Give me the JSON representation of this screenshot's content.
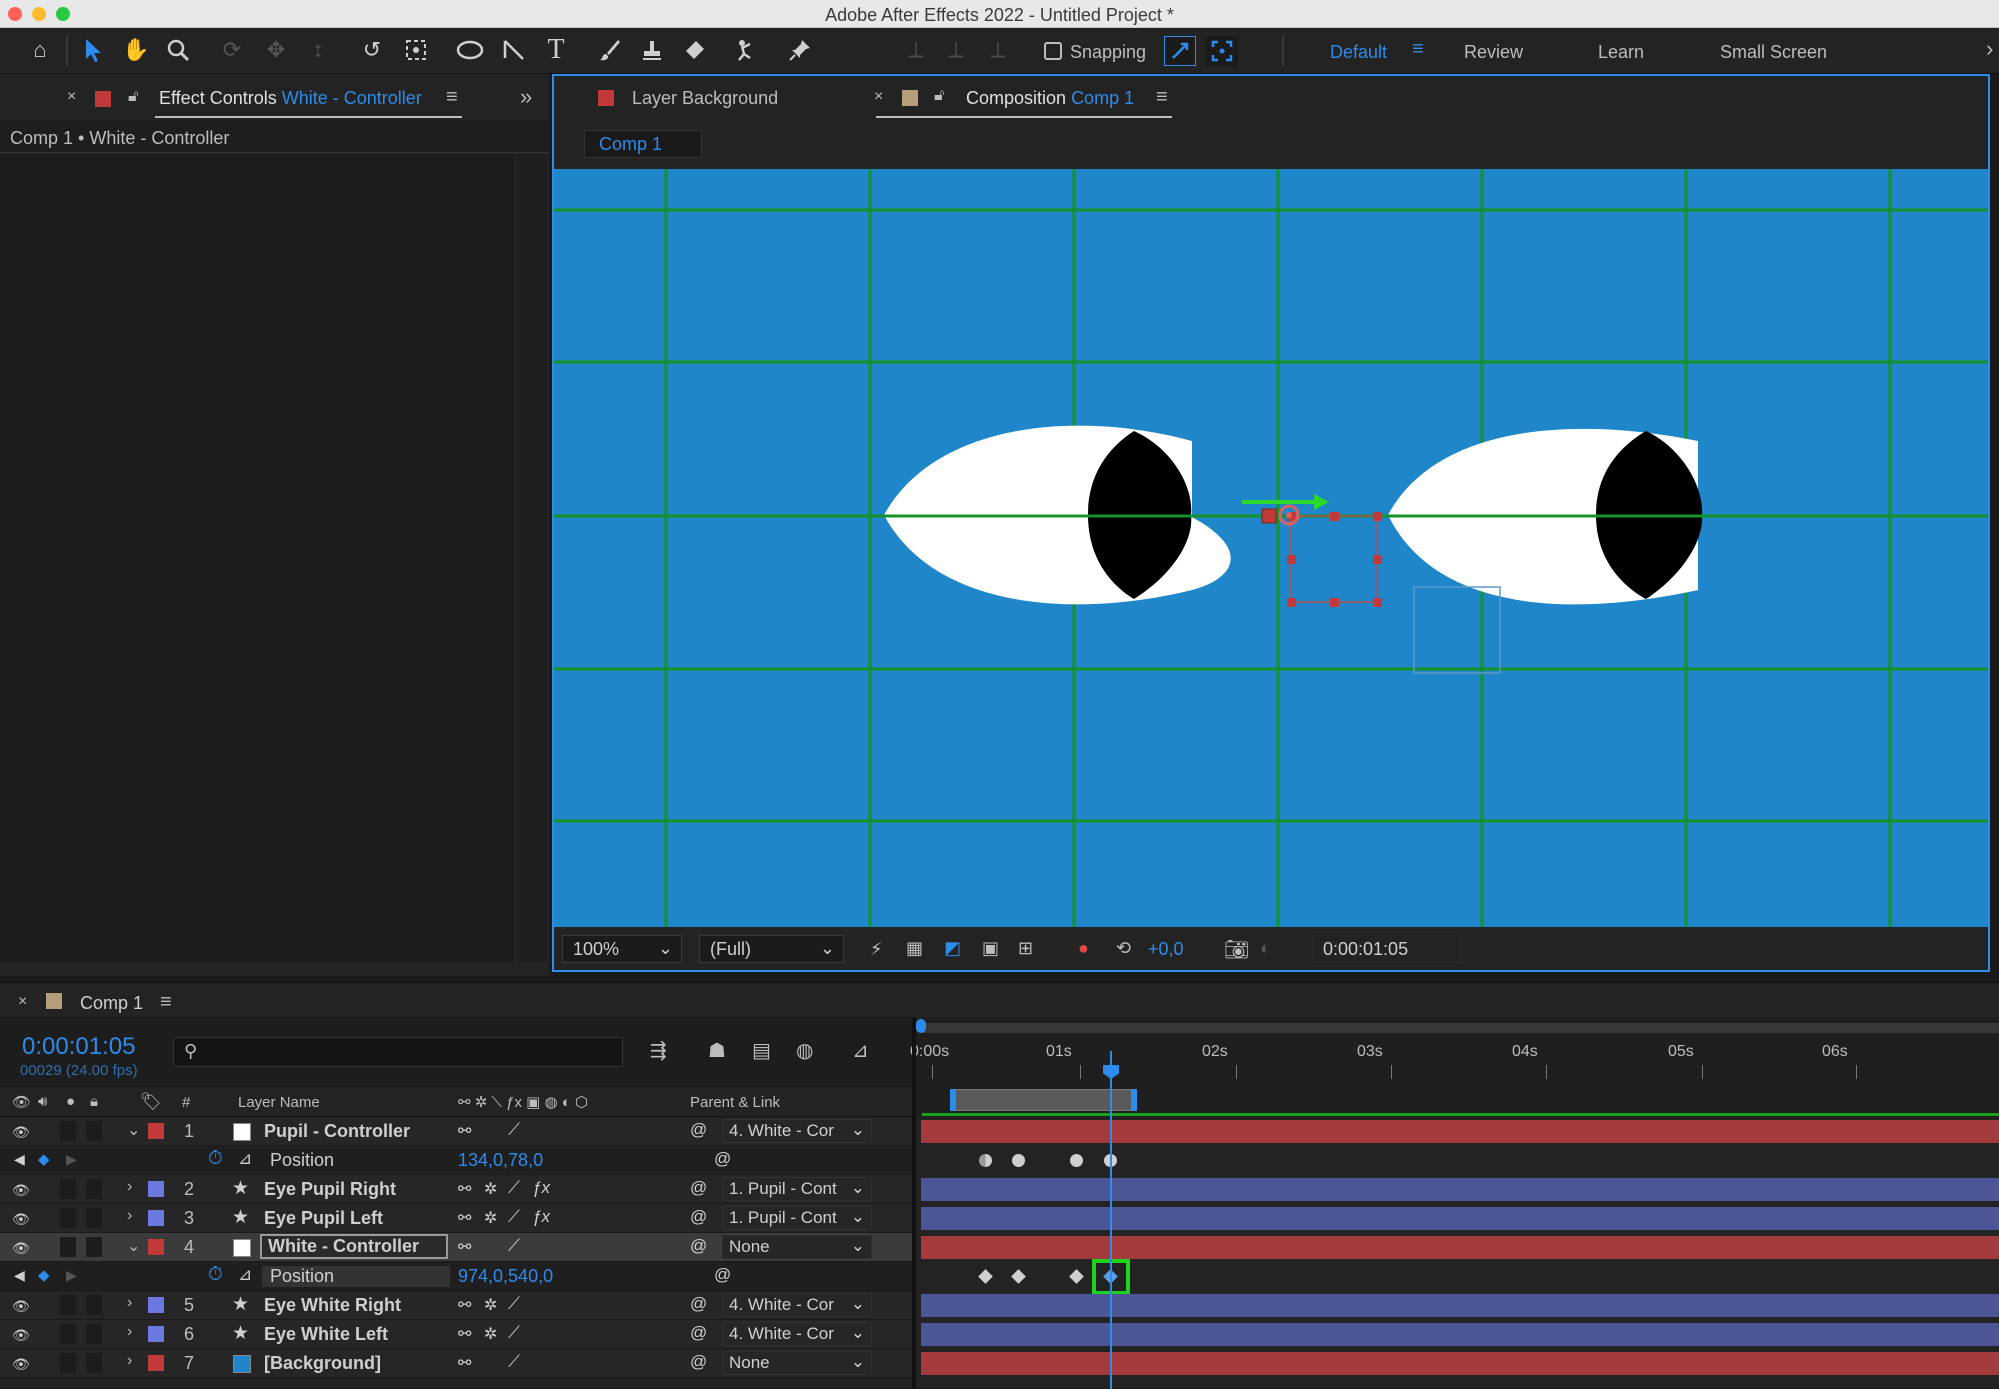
{
  "window": {
    "title": "Adobe After Effects 2022 - Untitled Project *"
  },
  "toolbar": {
    "tools": [
      "home-icon",
      "selection-icon",
      "hand-icon",
      "zoom-icon",
      "orbit-icon",
      "pan-icon",
      "dolly-icon",
      "rotate-icon",
      "camera-behind-icon",
      "ellipse-icon",
      "pen-icon",
      "type-icon",
      "brush-icon",
      "clone-stamp-icon",
      "eraser-icon",
      "roto-brush-icon",
      "puppet-pin-icon"
    ],
    "snapping_label": "Snapping",
    "workspaces": {
      "default": "Default",
      "review": "Review",
      "learn": "Learn",
      "small_screen": "Small Screen"
    }
  },
  "effect_controls": {
    "tab_label": "Effect Controls",
    "tab_layer": "White - Controller",
    "breadcrumb": "Comp 1 • White - Controller"
  },
  "viewer": {
    "tab_layer_label": "Layer",
    "tab_layer_name": "Background",
    "tab_comp_label": "Composition",
    "tab_comp_name": "Comp 1",
    "subtab": "Comp 1",
    "background_color": "#1f87c9",
    "grid_color": "#15922a",
    "zoom": "100%",
    "resolution": "(Full)",
    "exposure": "+0,0",
    "timecode": "0:00:01:05"
  },
  "timeline": {
    "tab_name": "Comp 1",
    "current_time": "0:00:01:05",
    "frame_info": "00029 (24.00 fps)",
    "col_number": "#",
    "col_layer_name": "Layer Name",
    "col_parent": "Parent & Link",
    "ruler": [
      "0:00s",
      "01s",
      "02s",
      "03s",
      "04s",
      "05s",
      "06s"
    ],
    "layers": [
      {
        "num": "1",
        "name": "Pupil - Controller",
        "color": "#c2393a",
        "parent": "4. White - Cor",
        "type": "solid"
      },
      {
        "num": "2",
        "name": "Eye Pupil Right",
        "color": "#6d77e0",
        "parent": "1. Pupil - Cont",
        "type": "shape"
      },
      {
        "num": "3",
        "name": "Eye Pupil Left",
        "color": "#6d77e0",
        "parent": "1. Pupil - Cont",
        "type": "shape"
      },
      {
        "num": "4",
        "name": "White - Controller",
        "color": "#c2393a",
        "parent": "None",
        "type": "solid"
      },
      {
        "num": "5",
        "name": "Eye White Right",
        "color": "#6d77e0",
        "parent": "4. White - Cor",
        "type": "shape"
      },
      {
        "num": "6",
        "name": "Eye White Left",
        "color": "#6d77e0",
        "parent": "4. White - Cor",
        "type": "shape"
      },
      {
        "num": "7",
        "name": "[Background]",
        "color": "#c2393a",
        "parent": "None",
        "type": "solid"
      }
    ],
    "props": {
      "pupil_position_label": "Position",
      "pupil_position_value": "134,0,78,0",
      "white_position_label": "Position",
      "white_position_value": "974,0,540,0"
    }
  }
}
